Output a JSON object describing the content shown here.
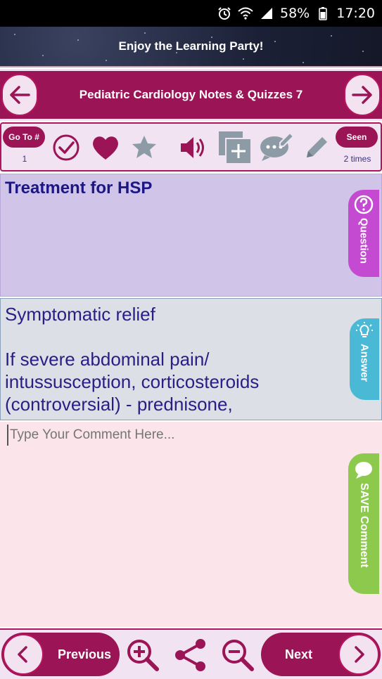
{
  "status_bar": {
    "battery": "58%",
    "time": "17:20",
    "icons": [
      "alarm-icon",
      "wifi-icon",
      "signal-icon",
      "battery-icon"
    ]
  },
  "banner": {
    "title": "Enjoy the Learning Party!"
  },
  "header": {
    "title": "Pediatric Cardiology Notes & Quizzes 7",
    "back_icon": "arrow-left-icon",
    "forward_icon": "arrow-right-icon"
  },
  "toolbar": {
    "goto_label": "Go To #",
    "goto_value": "1",
    "seen_label": "Seen",
    "seen_value": "2 times",
    "icons": [
      "check-icon",
      "heart-icon",
      "star-icon",
      "speaker-icon",
      "add-copy-icon",
      "comment-edit-icon",
      "pencil-icon"
    ]
  },
  "question": {
    "text": "Treatment for HSP",
    "tab_label": "Question"
  },
  "answer": {
    "text": "Symptomatic relief\n\nIf severe abdominal pain/ intussusception, corticosteroids (controversial) - prednisone, methylprednisone",
    "tab_label": "Answer"
  },
  "comment": {
    "placeholder": "Type Your Comment Here...",
    "tab_label": "SAVE Comment"
  },
  "bottom_bar": {
    "previous_label": "Previous",
    "next_label": "Next",
    "icons": [
      "zoom-in-icon",
      "share-icon",
      "zoom-out-icon"
    ]
  },
  "colors": {
    "primary": "#9b1455",
    "panel_bg": "#f1e3f1",
    "question_bg": "#d0c4e8",
    "answer_bg": "#dcdfe6",
    "comment_bg": "#fbe5ea",
    "question_tab": "#c44ad2",
    "answer_tab": "#49b9d6",
    "comment_tab": "#8cc94c",
    "text_dark_blue": "#1b1785"
  }
}
